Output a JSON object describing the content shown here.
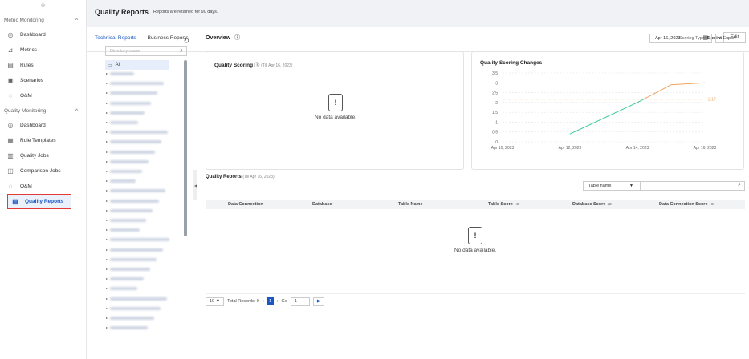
{
  "sidebar": {
    "top_icon": "⊕",
    "sections": [
      {
        "title": "Metric Monitoring",
        "toggle": "^",
        "items": [
          {
            "label": "Dashboard",
            "icon": "dashboard-icon",
            "glyph": "◎"
          },
          {
            "label": "Metrics",
            "icon": "metrics-icon",
            "glyph": "⊿"
          },
          {
            "label": "Rules",
            "icon": "rules-icon",
            "glyph": "▤"
          },
          {
            "label": "Scenarios",
            "icon": "scenarios-icon",
            "glyph": "▣"
          },
          {
            "label": "O&M",
            "icon": "om-icon",
            "glyph": "◌"
          }
        ]
      },
      {
        "title": "Quality Monitoring",
        "toggle": "^",
        "items": [
          {
            "label": "Dashboard",
            "icon": "dashboard-icon",
            "glyph": "◎"
          },
          {
            "label": "Rule Templates",
            "icon": "rule-templates-icon",
            "glyph": "▦"
          },
          {
            "label": "Quality Jobs",
            "icon": "quality-jobs-icon",
            "glyph": "▥"
          },
          {
            "label": "Comparison Jobs",
            "icon": "comparison-jobs-icon",
            "glyph": "◫"
          },
          {
            "label": "O&M",
            "icon": "om-icon",
            "glyph": "◌"
          },
          {
            "label": "Quality Reports",
            "icon": "quality-reports-icon",
            "glyph": "▤",
            "active": true
          }
        ]
      }
    ]
  },
  "header": {
    "title": "Quality Reports",
    "note": "Reports are retained for 90 days."
  },
  "tabs": [
    {
      "label": "Technical Reports",
      "active": true
    },
    {
      "label": "Business Reports",
      "active": false
    }
  ],
  "scoring_type": {
    "label": "Scoring Type:",
    "value": "5 point"
  },
  "edit_label": "Edit",
  "tree": {
    "placeholder": "Directory name",
    "root": "All"
  },
  "overview": {
    "title": "Overview",
    "date": "Apr 16, 2023",
    "export_label": "Export"
  },
  "quality_scoring": {
    "title": "Quality Scoring",
    "subtitle": "(Till Apr 16, 2023)",
    "empty_text": "No data available."
  },
  "changes": {
    "title": "Quality Scoring Changes"
  },
  "reports": {
    "title": "Quality Reports",
    "subtitle": "(Till Apr 16, 2023)",
    "filter_value": "Table name",
    "columns": [
      "Data Connection",
      "Database",
      "Table Name",
      "Table Score",
      "Database Score",
      "Data Connection Score"
    ],
    "empty_text": "No data available.",
    "pagination": {
      "page_size": "10",
      "total": "Total Records: 0",
      "current": "1",
      "go_label": "Go",
      "go_value": "1"
    }
  },
  "chart_data": {
    "type": "line",
    "title": "Quality Scoring Changes",
    "x": [
      "Apr 10, 2023",
      "Apr 11, 2023",
      "Apr 12, 2023",
      "Apr 13, 2023",
      "Apr 14, 2023",
      "Apr 15, 2023",
      "Apr 16, 2023"
    ],
    "x_ticks": [
      "Apr 10, 2023",
      "Apr 12, 2023",
      "Apr 14, 2023",
      "Apr 16, 2023"
    ],
    "series": [
      {
        "values": [
          null,
          null,
          0.4,
          1.2,
          2.0,
          2.9,
          3.0
        ],
        "colors": {
          "below": "#3cc99b",
          "above": "#f0a25b"
        }
      }
    ],
    "threshold": {
      "value": 2.17,
      "label": "2.17",
      "color": "#f0a25b"
    },
    "ylim": [
      0,
      3.5
    ],
    "y_ticks": [
      "0",
      "0.5",
      "1",
      "1.5",
      "2",
      "2.5",
      "3",
      "3.5"
    ],
    "grid": true
  },
  "colors": {
    "accent": "#1a56c4",
    "highlight": "#e53935"
  }
}
